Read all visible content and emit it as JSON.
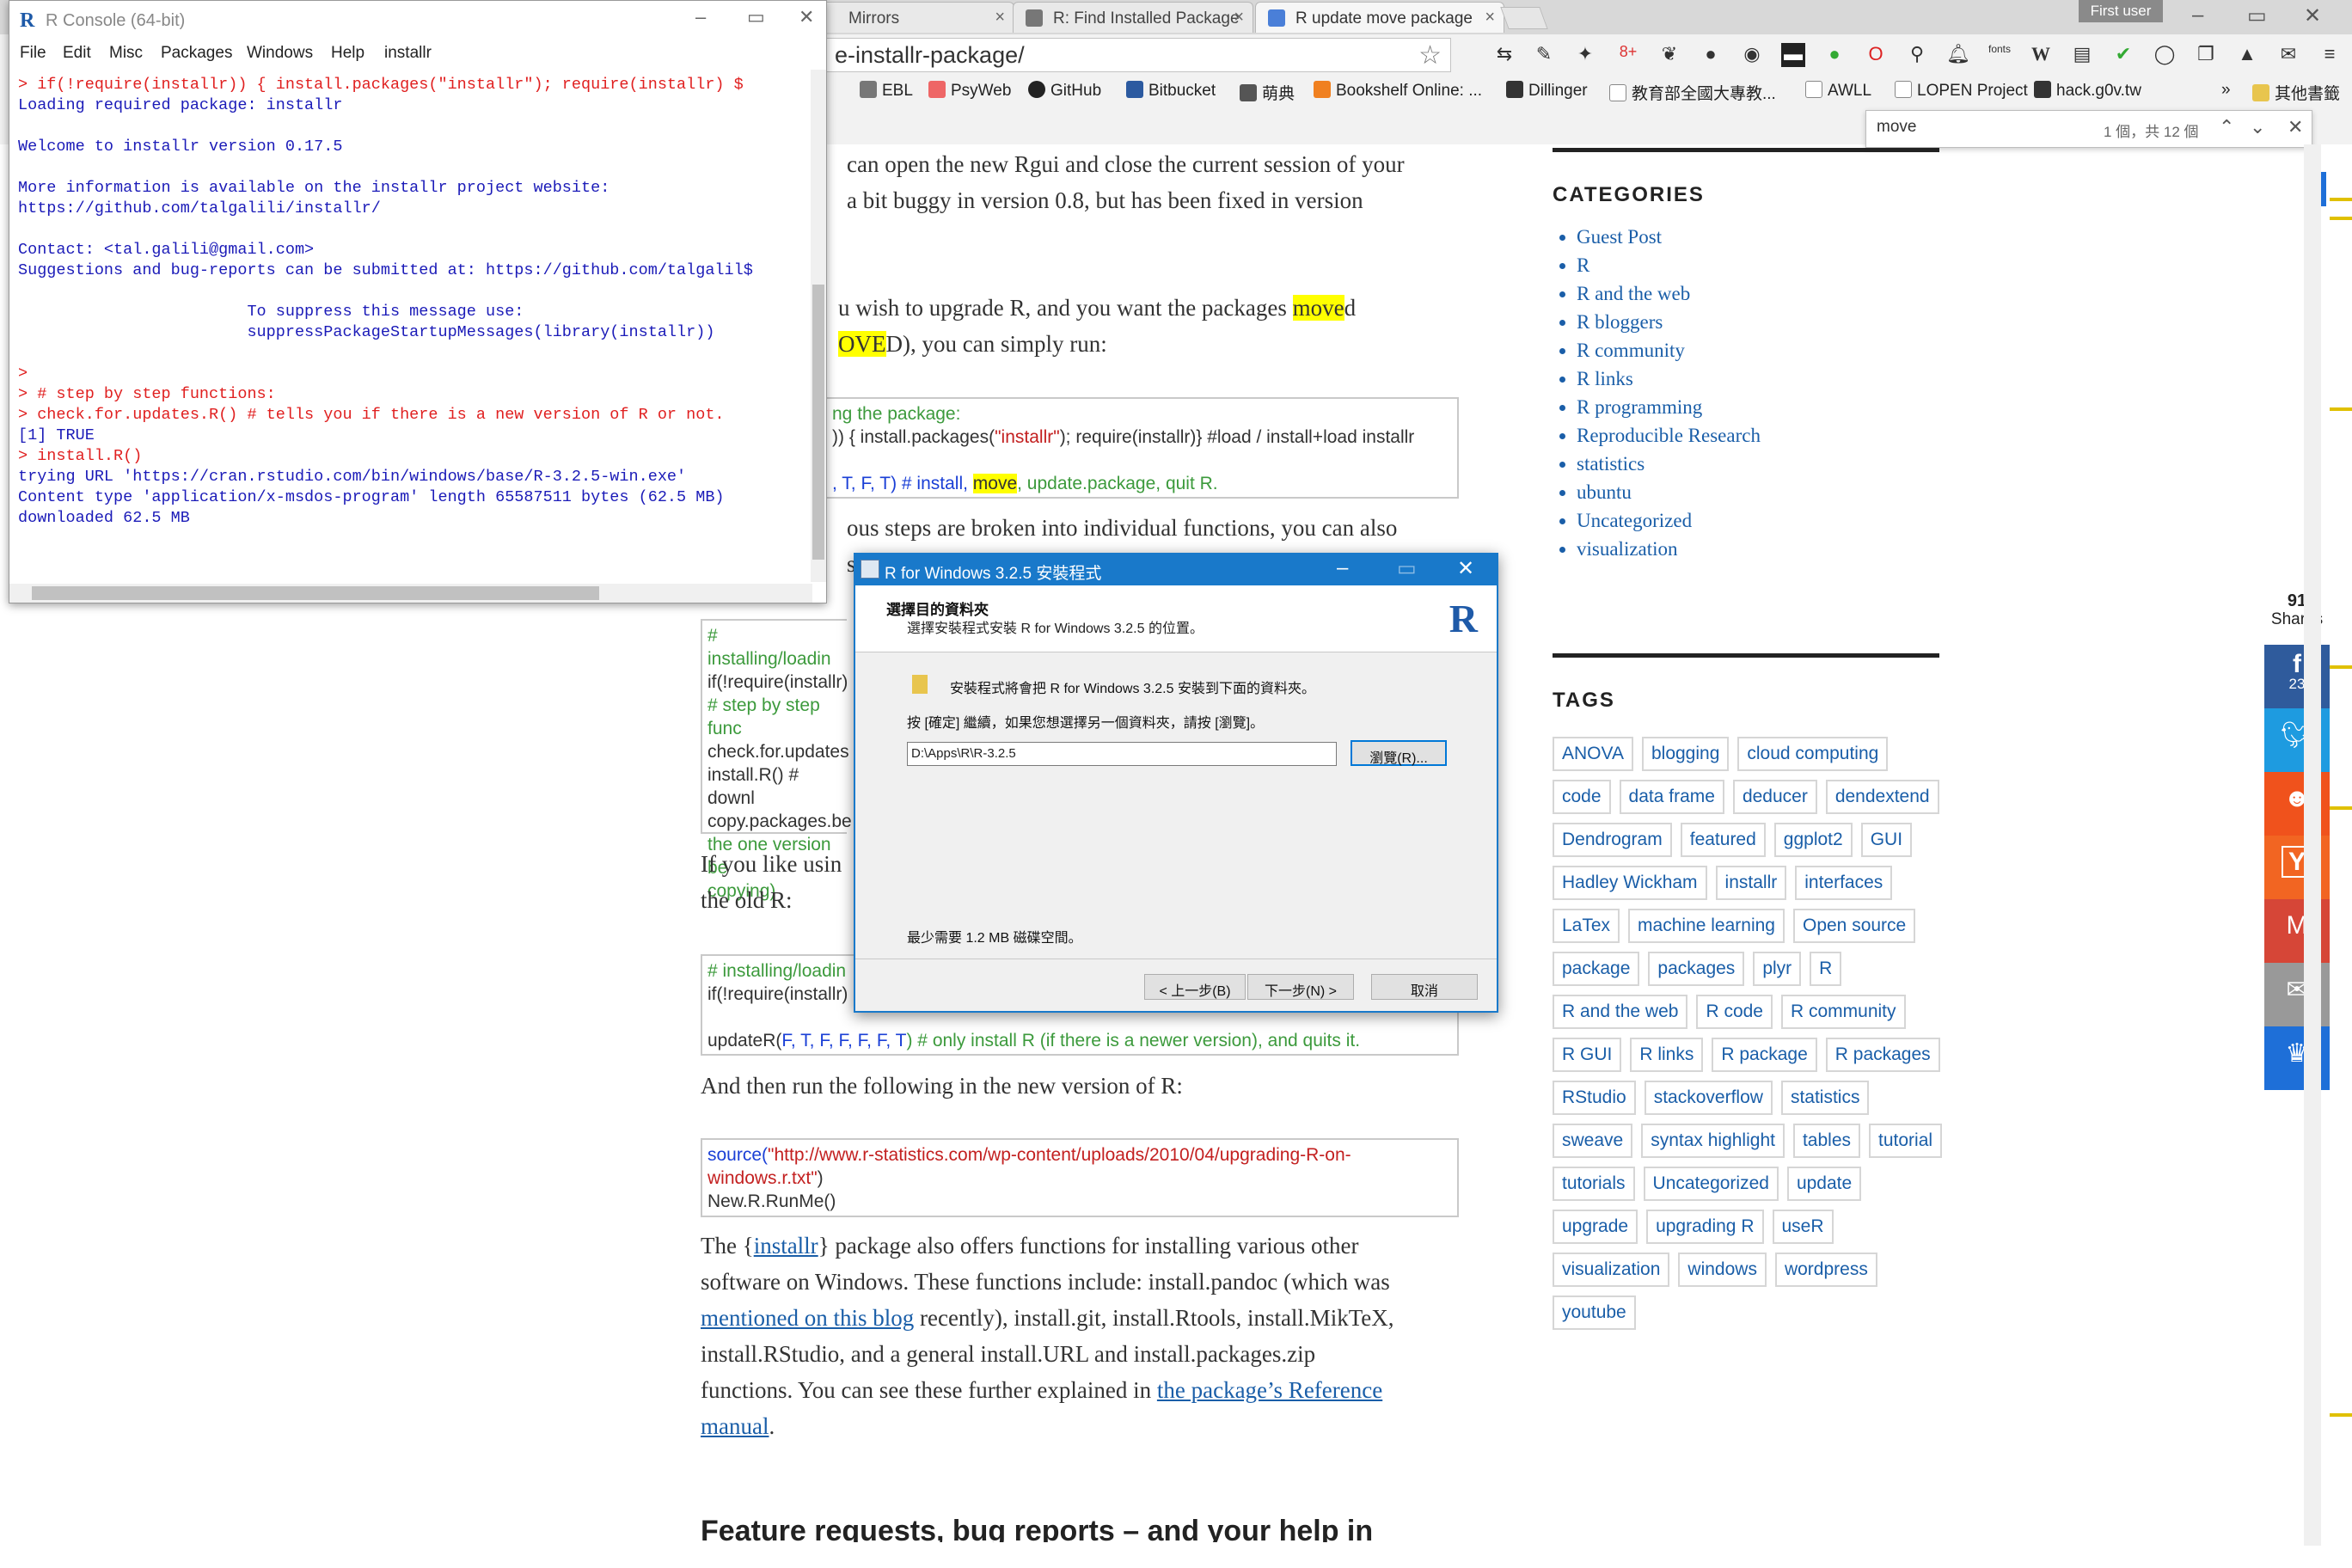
{
  "browser": {
    "tabs": [
      {
        "label": "Mirrors"
      },
      {
        "label": "R: Find Installed Package"
      },
      {
        "label": "R update move package"
      }
    ],
    "user_badge": "First user",
    "address": "e-installr-package/",
    "bookmarks": [
      "EBL",
      "PsyWeb",
      "GitHub",
      "Bitbucket",
      "萌典",
      "Bookshelf Online: ...",
      "Dillinger",
      "教育部全國大專教...",
      "AWLL",
      "LOPEN Project",
      "hack.g0v.tw",
      "»",
      "其他書籤"
    ],
    "find": {
      "query": "move",
      "count": "1 個，共 12 個"
    },
    "ext_labels": {
      "gplus": "8+",
      "fonts": "fonts",
      "w": "W"
    }
  },
  "article": {
    "p1": "can open the new Rgui and close the current session of your",
    "p1b": "a bit buggy in version 0.8, but has been fixed in version",
    "p2a": "u wish to upgrade R, and you want the packages ",
    "p2hl": "move",
    "p2end": "d",
    "p2b_hl": "OVE",
    "p2b_rest": "D), you can simply run:",
    "code1_l1": "ng the package:",
    "code1_l2a": ")) { install.packages(",
    "code1_l2str": "\"installr\"",
    "code1_l2b": "); require(installr)} #load / install+load installr",
    "code1_l3a": ", T, F, T) # install, ",
    "code1_l3hl": "move",
    "code1_l3b": ", update.package, quit R.",
    "p3": "ous steps are broken into individual functions, you can also",
    "p3b": "s",
    "code2": [
      "# installing/loadin",
      "if(!require(installr)",
      "",
      "# step by step func",
      "check.for.updates",
      "install.R() # downl",
      "copy.packages.be",
      "the one version be",
      "copying)"
    ],
    "p4a": "If you like usin",
    "p4b": "the old R:",
    "code3_l1": "# installing/loadin",
    "code3_l2": "if(!require(installr)",
    "code3_l3a": "updateR(",
    "code3_l3args": "F, T, F, F, F, F, T",
    "code3_l3b": ") # only install R (if there is a newer version), and quits it.",
    "p5": "And then run the following in the new version of R:",
    "code4_l1a": "source(",
    "code4_l1str": "\"http://www.r-statistics.com/wp-content/uploads/2010/04/upgrading-R-on-",
    "code4_l2str": "windows.r.txt\"",
    "code4_l2b": ")",
    "code4_l3": "New.R.RunMe()",
    "p6_1a": "The {",
    "p6_1link": "installr",
    "p6_1b": "} package also offers functions for installing various other",
    "p6_2": "software on Windows. These functions include: install.pandoc (which was",
    "p6_3link": "mentioned on this blog",
    "p6_3b": " recently), install.git, install.Rtools, install.MikTeX,",
    "p6_4": "install.RStudio, and a general install.URL and install.packages.zip",
    "p6_5a": "functions. You can see these further explained in ",
    "p6_5link": "the package’s Reference",
    "p6_6link": "manual",
    "p6_6b": ".",
    "h_next": "Feature requests, bug reports – and your help in"
  },
  "sidebar": {
    "categories_title": "CATEGORIES",
    "categories": [
      "Guest Post",
      "R",
      "R and the web",
      "R bloggers",
      "R community",
      "R links",
      "R programming",
      "Reproducible Research",
      "statistics",
      "ubuntu",
      "Uncategorized",
      "visualization"
    ],
    "tags_title": "TAGS",
    "tags": [
      "ANOVA",
      "blogging",
      "cloud computing",
      "code",
      "data frame",
      "deducer",
      "dendextend",
      "Dendrogram",
      "featured",
      "ggplot2",
      "GUI",
      "Hadley Wickham",
      "installr",
      "interfaces",
      "LaTex",
      "machine learning",
      "Open source",
      "package",
      "packages",
      "plyr",
      "R",
      "R and the web",
      "R code",
      "R community",
      "R GUI",
      "R links",
      "R package",
      "R packages",
      "RStudio",
      "stackoverflow",
      "statistics",
      "sweave",
      "syntax highlight",
      "tables",
      "tutorial",
      "tutorials",
      "Uncategorized",
      "update",
      "upgrade",
      "upgrading R",
      "useR",
      "visualization",
      "windows",
      "wordpress",
      "youtube"
    ]
  },
  "share": {
    "count": "91",
    "label": "Shares",
    "facebook_count": "23"
  },
  "rconsole": {
    "title": "R Console (64-bit)",
    "menu": [
      "File",
      "Edit",
      "Misc",
      "Packages",
      "Windows",
      "Help",
      "installr"
    ],
    "lines": [
      {
        "t": "> if(!require(installr)) { install.packages(\"installr\"); require(installr) $",
        "cmd": true
      },
      {
        "t": "Loading required package: installr",
        "cmd": false
      },
      {
        "t": "",
        "cmd": false
      },
      {
        "t": "Welcome to installr version 0.17.5",
        "cmd": false
      },
      {
        "t": "",
        "cmd": false
      },
      {
        "t": "More information is available on the installr project website:",
        "cmd": false
      },
      {
        "t": "https://github.com/talgalili/installr/",
        "cmd": false
      },
      {
        "t": "",
        "cmd": false
      },
      {
        "t": "Contact: <tal.galili@gmail.com>",
        "cmd": false
      },
      {
        "t": "Suggestions and bug-reports can be submitted at: https://github.com/talgalil$",
        "cmd": false
      },
      {
        "t": "",
        "cmd": false
      },
      {
        "t": "                        To suppress this message use:",
        "cmd": false
      },
      {
        "t": "                        suppressPackageStartupMessages(library(installr))",
        "cmd": false
      },
      {
        "t": "",
        "cmd": false
      },
      {
        "t": ">",
        "cmd": true
      },
      {
        "t": "> # step by step functions:",
        "cmd": true
      },
      {
        "t": "> check.for.updates.R() # tells you if there is a new version of R or not.",
        "cmd": true
      },
      {
        "t": "[1] TRUE",
        "cmd": false
      },
      {
        "t": "> install.R()",
        "cmd": true
      },
      {
        "t": "trying URL 'https://cran.rstudio.com/bin/windows/base/R-3.2.5-win.exe'",
        "cmd": false
      },
      {
        "t": "Content type 'application/x-msdos-program' length 65587511 bytes (62.5 MB)",
        "cmd": false
      },
      {
        "t": "downloaded 62.5 MB",
        "cmd": false
      }
    ]
  },
  "setup": {
    "title": "R for Windows 3.2.5 安裝程式",
    "heading": "選擇目的資料夾",
    "subheading": "選擇安裝程式安裝 R for Windows 3.2.5 的位置。",
    "line1": "安裝程式將會把 R for Windows 3.2.5 安裝到下面的資料夾。",
    "line2": "按 [確定] 繼續，如果您想選擇另一個資料夾，請按 [瀏覽]。",
    "path": "D:\\Apps\\R\\R-3.2.5",
    "browse": "瀏覽(R)...",
    "space": "最少需要 1.2 MB 磁碟空間。",
    "back": "< 上一步(B)",
    "next": "下一步(N) >",
    "cancel": "取消",
    "logo": "R"
  }
}
